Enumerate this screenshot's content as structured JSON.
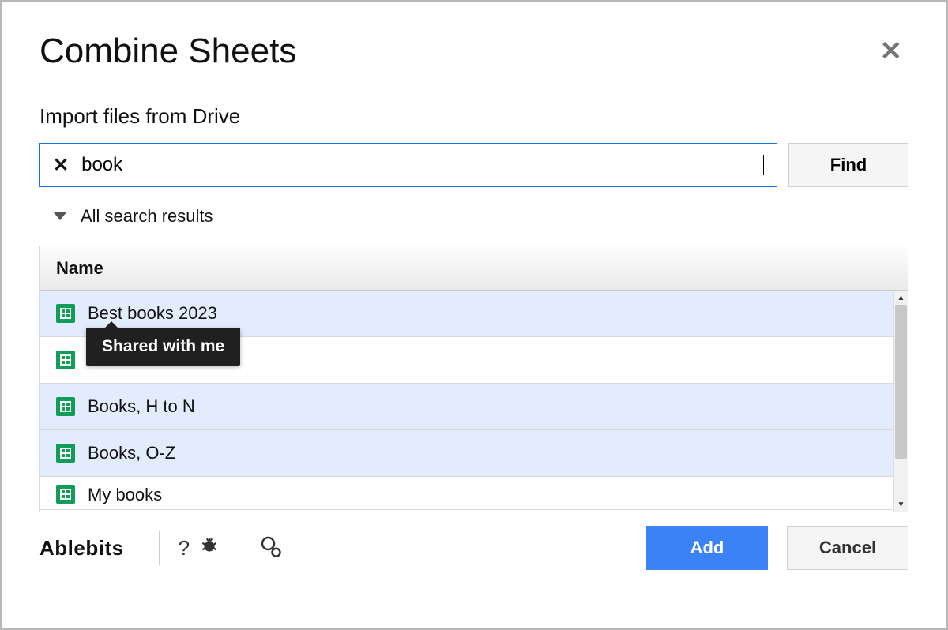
{
  "window": {
    "title": "Combine Sheets",
    "subtitle": "Import files from Drive"
  },
  "search": {
    "value": "book",
    "findLabel": "Find"
  },
  "filter": {
    "label": "All search results"
  },
  "table": {
    "header": "Name",
    "rows": [
      {
        "name": "Best books 2023",
        "selected": true
      },
      {
        "name": "",
        "selected": false
      },
      {
        "name": "Books, H to N",
        "selected": true
      },
      {
        "name": "Books, O-Z",
        "selected": true
      },
      {
        "name": "My books",
        "selected": false
      }
    ]
  },
  "tooltip": "Shared with me",
  "footer": {
    "brand": "Ablebits",
    "addLabel": "Add",
    "cancelLabel": "Cancel"
  }
}
